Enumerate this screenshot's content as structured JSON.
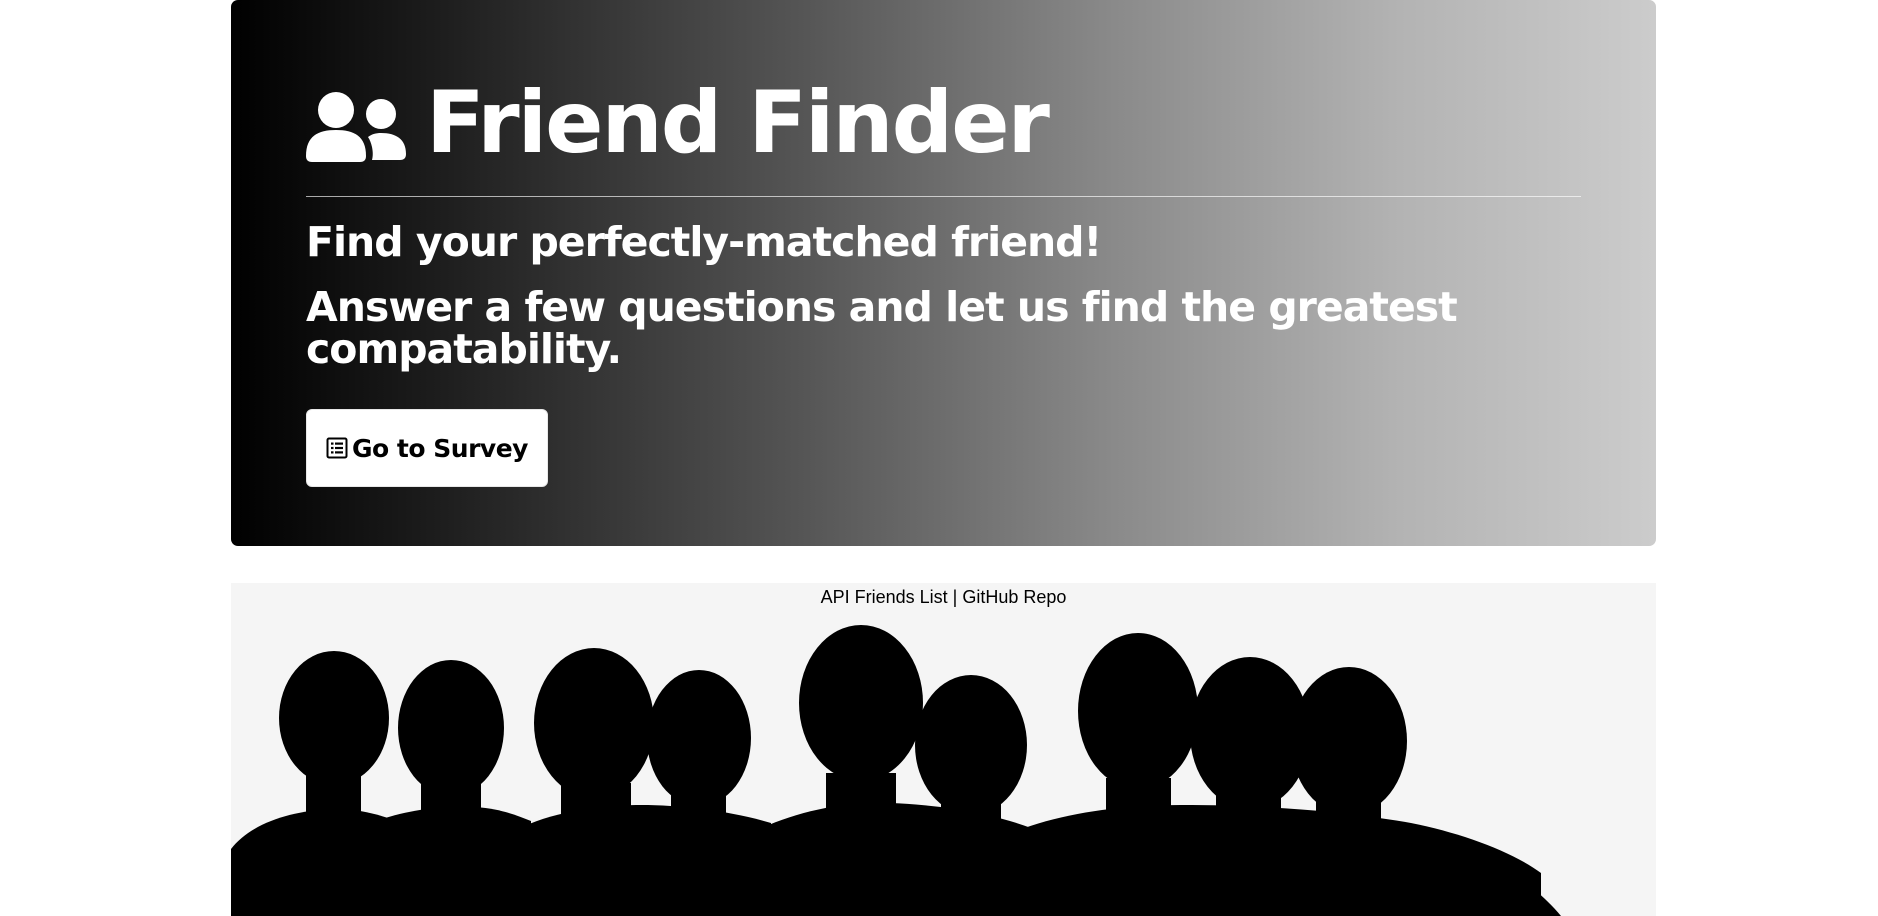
{
  "hero": {
    "title": "Friend Finder",
    "title_icon": "user-friends-icon",
    "lead": "Find your perfectly-matched friend!",
    "sublead": "Answer a few questions and let us find the greatest compatability.",
    "button": {
      "icon": "list-alt-icon",
      "label": "Go to Survey"
    }
  },
  "footer": {
    "links": [
      {
        "label": "API Friends List"
      },
      {
        "label": "GitHub Repo"
      }
    ],
    "separator": " | ",
    "image": "group-silhouette-image"
  },
  "colors": {
    "hero_gradient_start": "#000000",
    "hero_gradient_end": "#cccccc",
    "footer_background": "#f5f5f5",
    "button_background": "#ffffff"
  }
}
